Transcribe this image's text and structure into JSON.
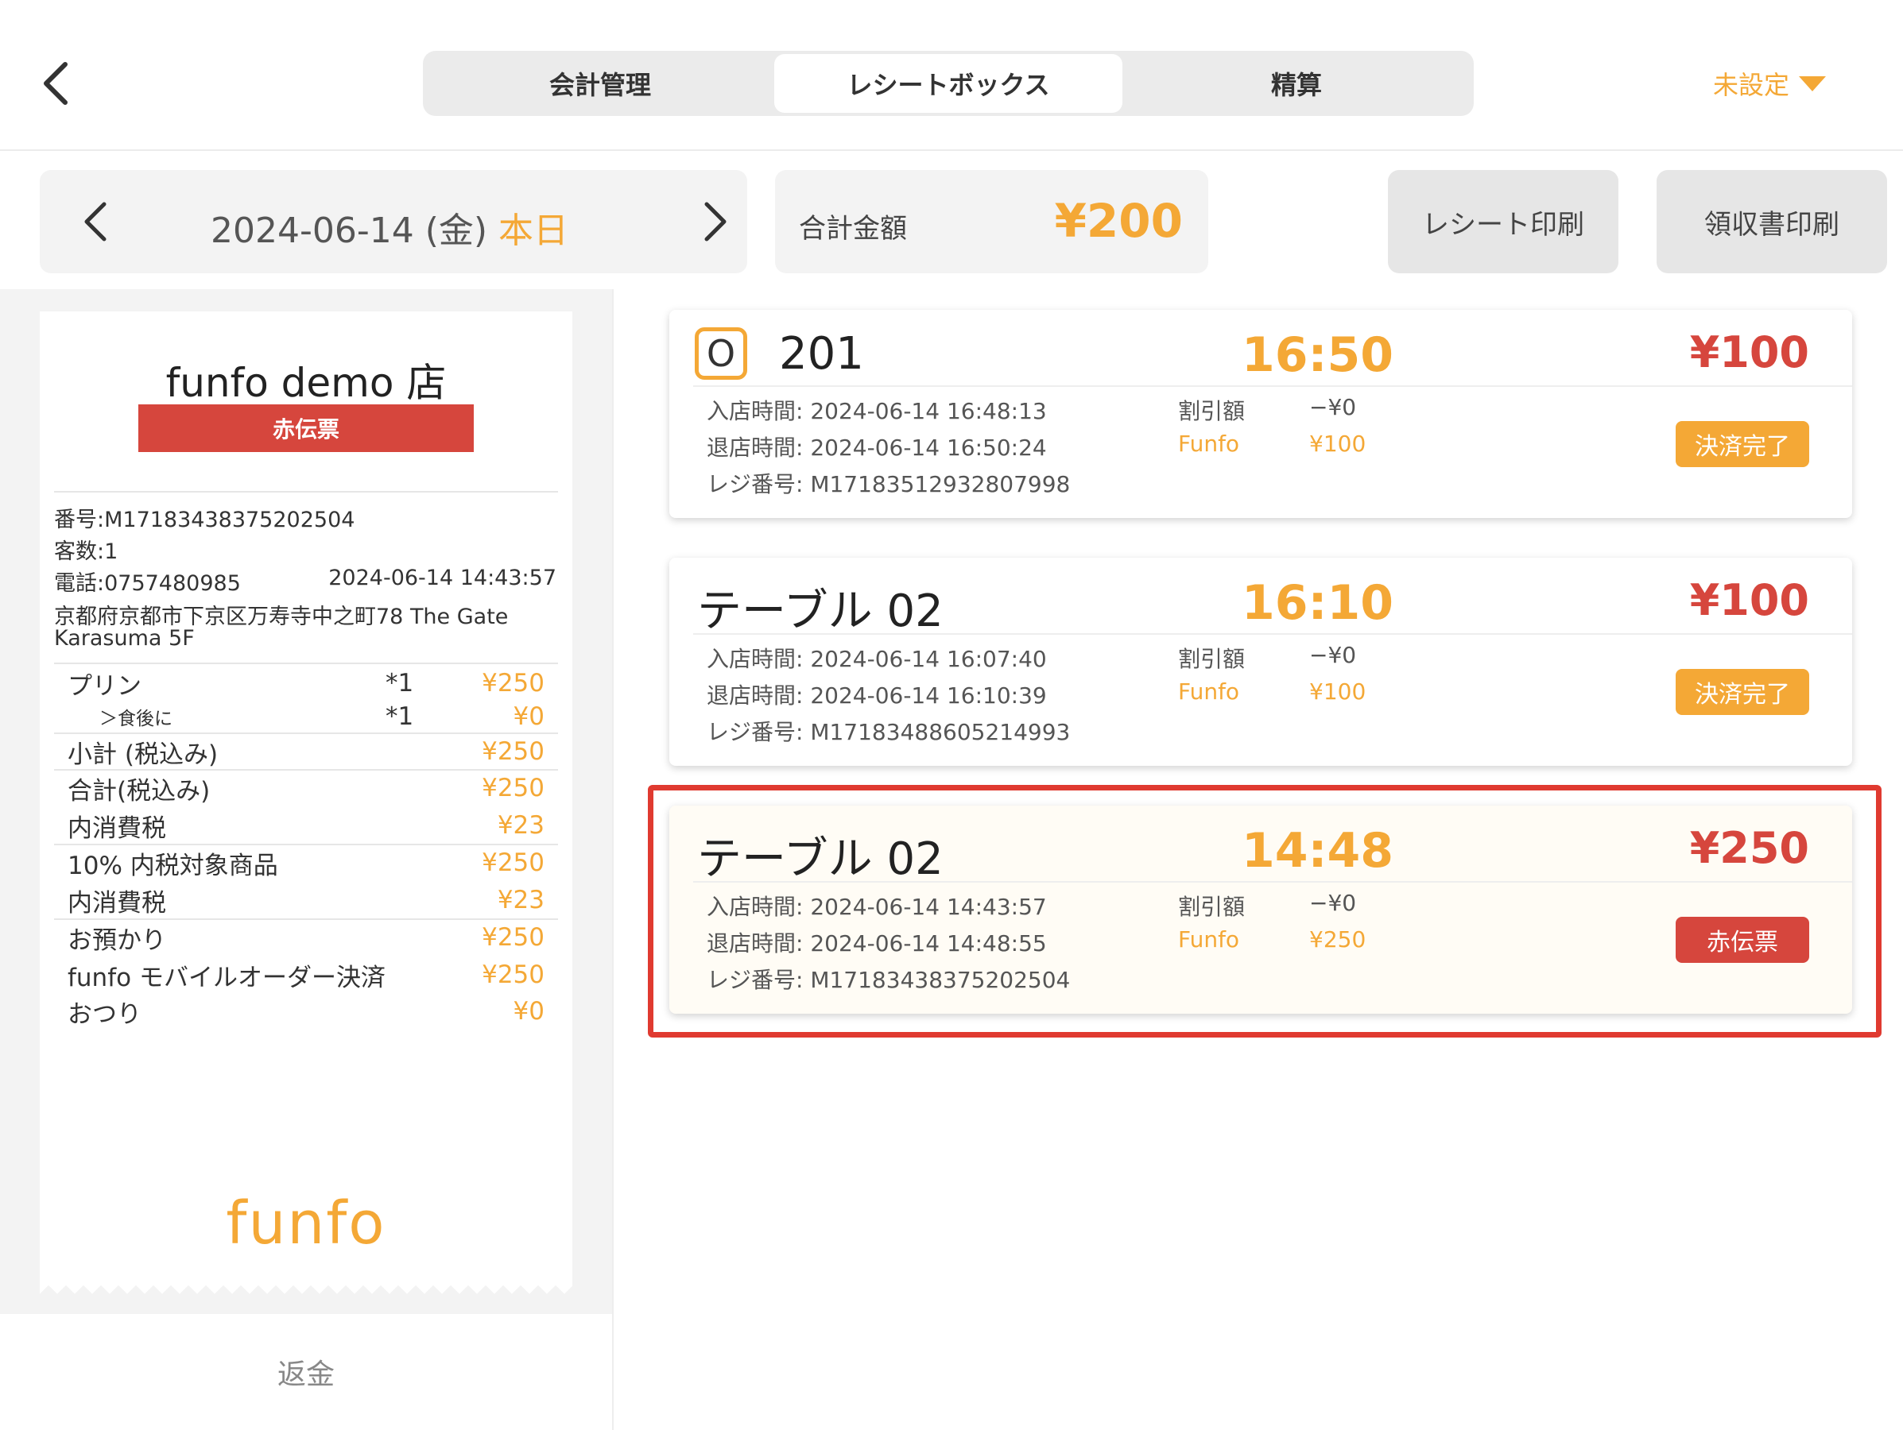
{
  "header": {
    "tabs": [
      {
        "label": "会計管理"
      },
      {
        "label": "レシートボックス"
      },
      {
        "label": "精算"
      }
    ],
    "store_select": "未設定"
  },
  "filter": {
    "date": "2024-06-14 (金)",
    "today": "本日",
    "total_label": "合計金額",
    "total_value": "¥200",
    "receipt_print": "レシート印刷",
    "invoice_print": "領収書印刷"
  },
  "receipt": {
    "store": "funfo demo 店",
    "badge": "赤伝票",
    "number": "番号:M17183438375202504",
    "guests": "客数:1",
    "phone": "電話:0757480985",
    "datetime": "2024-06-14 14:43:57",
    "address1": "京都府京都市下京区万寿寺中之町78 The Gate",
    "address2": "Karasuma 5F",
    "items": [
      {
        "name": "プリン",
        "qty": "*1",
        "price": "¥250"
      },
      {
        "name": "＞食後に",
        "qty": "*1",
        "price": "¥0"
      }
    ],
    "lines": [
      {
        "name": "小計 (税込み)",
        "price": "¥250"
      },
      {
        "name": "合計(税込み)",
        "price": "¥250"
      },
      {
        "name": "内消費税",
        "price": "¥23"
      },
      {
        "name": "10% 内税対象商品",
        "price": "¥250"
      },
      {
        "name": "内消費税",
        "price": "¥23"
      },
      {
        "name": "お預かり",
        "price": "¥250"
      },
      {
        "name": "funfo モバイルオーダー決済",
        "price": "¥250"
      },
      {
        "name": "おつり",
        "price": "¥0"
      }
    ],
    "logo": "funfo",
    "refund": "返金"
  },
  "cards": [
    {
      "badge": "O",
      "title": "201",
      "time": "16:50",
      "amount": "¥100",
      "entry": "入店時間:  2024-06-14 16:48:13",
      "exit": "退店時間:  2024-06-14 16:50:24",
      "register": "レジ番号:  M17183512932807998",
      "discount_label": "割引額",
      "discount_value": "−¥0",
      "pay_label": "Funfo",
      "pay_value": "¥100",
      "status": "決済完了"
    },
    {
      "title": "テーブル 02",
      "time": "16:10",
      "amount": "¥100",
      "entry": "入店時間:  2024-06-14 16:07:40",
      "exit": "退店時間:  2024-06-14 16:10:39",
      "register": "レジ番号:  M17183488605214993",
      "discount_label": "割引額",
      "discount_value": "−¥0",
      "pay_label": "Funfo",
      "pay_value": "¥100",
      "status": "決済完了"
    },
    {
      "title": "テーブル 02",
      "time": "14:48",
      "amount": "¥250",
      "entry": "入店時間:  2024-06-14 14:43:57",
      "exit": "退店時間:  2024-06-14 14:48:55",
      "register": "レジ番号:  M17183438375202504",
      "discount_label": "割引額",
      "discount_value": "−¥0",
      "pay_label": "Funfo",
      "pay_value": "¥250",
      "status": "赤伝票"
    }
  ],
  "colors": {
    "accent": "#f4a836",
    "red": "#d6463d",
    "highlight": "#e03a30"
  }
}
